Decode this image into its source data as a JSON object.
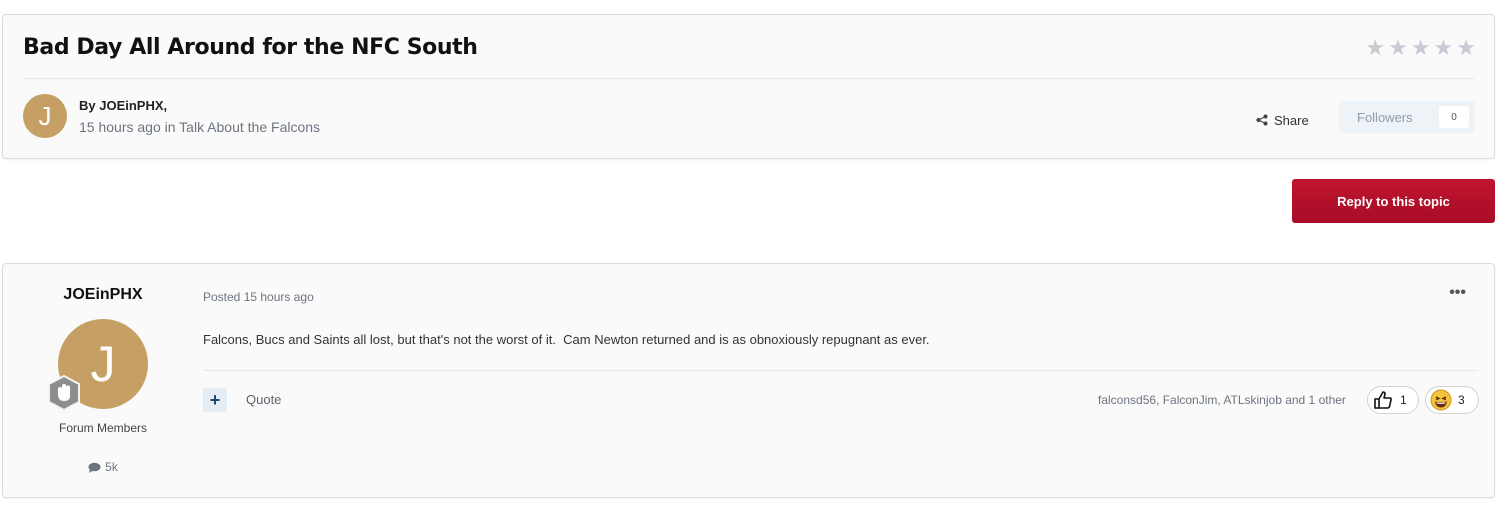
{
  "topic": {
    "title": "Bad Day All Around for the NFC South",
    "rating_stars": 5,
    "rating_value": 0,
    "author_avatar_letter": "J",
    "byline": "By JOEinPHX,",
    "time": "15 hours ago",
    "in_word": "in",
    "forum": "Talk About the Falcons",
    "share_label": "Share",
    "followers_label": "Followers",
    "followers_count": "0"
  },
  "actions": {
    "reply_label": "Reply to this topic"
  },
  "post": {
    "author": "JOEinPHX",
    "avatar_letter": "J",
    "group": "Forum Members",
    "post_count": "5k",
    "posted": "Posted 15 hours ago",
    "menu": "•••",
    "body": "Falcons, Bucs and Saints all lost, but that's not the worst of it.  Cam Newton returned and is as obnoxiously repugnant as ever.",
    "multiquote": "+",
    "quote_label": "Quote",
    "reaction_users": "falconsd56, FalconJim, ATLskinjob and 1 other",
    "reactions": [
      {
        "icon": "thumbs-up-icon",
        "count": "1"
      },
      {
        "icon": "haha-icon",
        "count": "3"
      }
    ]
  },
  "colors": {
    "accent_red": "#b5102a",
    "avatar_bg": "#c59f63",
    "muted_text": "#6c7580",
    "star_inactive": "#c7ccd4"
  }
}
